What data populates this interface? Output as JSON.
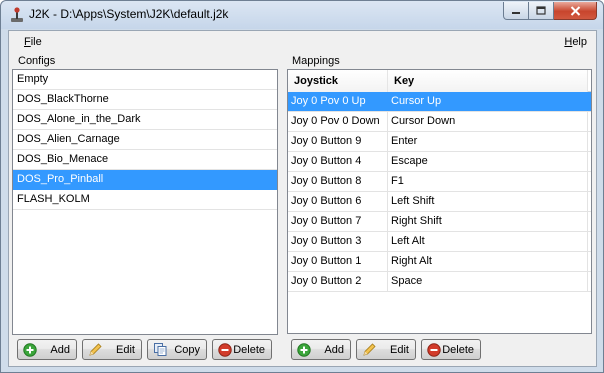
{
  "window": {
    "title": "J2K - D:\\Apps\\System\\J2K\\default.j2k"
  },
  "menu": {
    "file_prefix": "",
    "file_hotkey": "F",
    "file_rest": "ile",
    "help_hotkey": "H",
    "help_rest": "elp"
  },
  "configs": {
    "label": "Configs",
    "items": [
      {
        "label": "Empty",
        "selected": false
      },
      {
        "label": "DOS_BlackThorne",
        "selected": false
      },
      {
        "label": "DOS_Alone_in_the_Dark",
        "selected": false
      },
      {
        "label": "DOS_Alien_Carnage",
        "selected": false
      },
      {
        "label": "DOS_Bio_Menace",
        "selected": false
      },
      {
        "label": "DOS_Pro_Pinball",
        "selected": true
      },
      {
        "label": "FLASH_KOLM",
        "selected": false
      }
    ],
    "buttons": {
      "add": "Add",
      "edit": "Edit",
      "copy": "Copy",
      "delete": "Delete"
    }
  },
  "mappings": {
    "label": "Mappings",
    "columns": {
      "joystick": "Joystick",
      "key": "Key"
    },
    "rows": [
      {
        "joystick": "Joy 0 Pov 0 Up",
        "key": "Cursor Up",
        "selected": true
      },
      {
        "joystick": "Joy 0 Pov 0 Down",
        "key": "Cursor Down",
        "selected": false
      },
      {
        "joystick": "Joy 0 Button 9",
        "key": "Enter",
        "selected": false
      },
      {
        "joystick": "Joy 0 Button 4",
        "key": "Escape",
        "selected": false
      },
      {
        "joystick": "Joy 0 Button 8",
        "key": "F1",
        "selected": false
      },
      {
        "joystick": "Joy 0 Button 6",
        "key": "Left Shift",
        "selected": false
      },
      {
        "joystick": "Joy 0 Button 7",
        "key": "Right Shift",
        "selected": false
      },
      {
        "joystick": "Joy 0 Button 3",
        "key": "Left Alt",
        "selected": false
      },
      {
        "joystick": "Joy 0 Button 1",
        "key": "Right Alt",
        "selected": false
      },
      {
        "joystick": "Joy 0 Button 2",
        "key": "Space",
        "selected": false
      }
    ],
    "buttons": {
      "add": "Add",
      "edit": "Edit",
      "delete": "Delete"
    }
  },
  "colors": {
    "selection": "#3399ff",
    "add_icon": "#3aa53a",
    "delete_icon": "#d23b2a"
  },
  "icons": {
    "app": "joystick-icon",
    "add": "plus-circle-icon",
    "edit": "pencil-icon",
    "copy": "copy-icon",
    "delete": "minus-circle-icon"
  }
}
